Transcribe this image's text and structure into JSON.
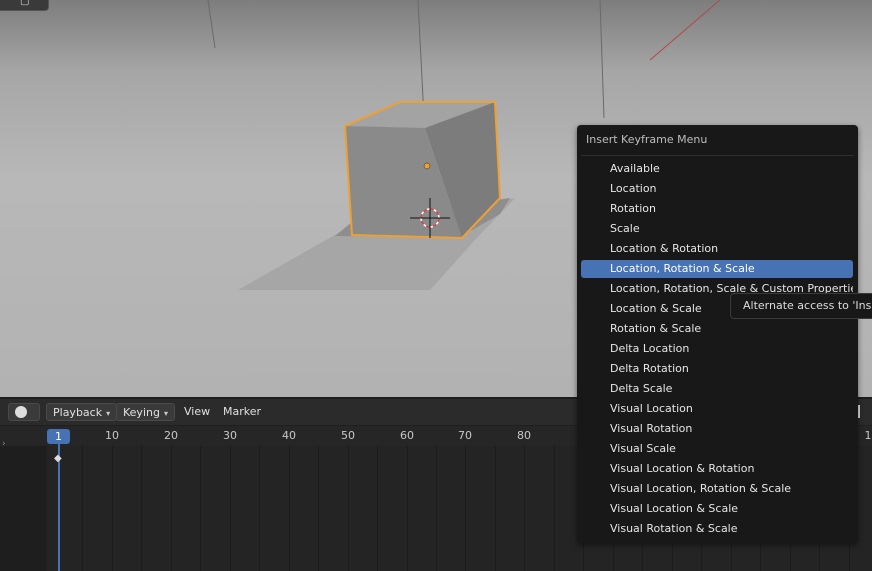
{
  "colors": {
    "accent": "#4772b3",
    "selection_outline": "#f0a030",
    "menu_bg": "#181818"
  },
  "timeline": {
    "editor_icon": "clock-icon",
    "menus": {
      "playback": "Playback",
      "keying": "Keying",
      "view": "View",
      "marker": "Marker"
    },
    "current_frame": "1",
    "ticks": [
      "10",
      "20",
      "30",
      "40",
      "50",
      "60",
      "70",
      "80"
    ],
    "right_tick": "1"
  },
  "menu": {
    "title": "Insert Keyframe Menu",
    "items": [
      "Available",
      "Location",
      "Rotation",
      "Scale",
      "Location & Rotation",
      "Location, Rotation & Scale",
      "Location, Rotation, Scale & Custom Properties",
      "Location & Scale",
      "Rotation & Scale",
      "Delta Location",
      "Delta Rotation",
      "Delta Scale",
      "Visual Location",
      "Visual Rotation",
      "Visual Scale",
      "Visual Location & Rotation",
      "Visual Location, Rotation & Scale",
      "Visual Location & Scale",
      "Visual Rotation & Scale"
    ],
    "active_index": 5
  },
  "tooltip": {
    "text": "Alternate access to 'Insert"
  }
}
